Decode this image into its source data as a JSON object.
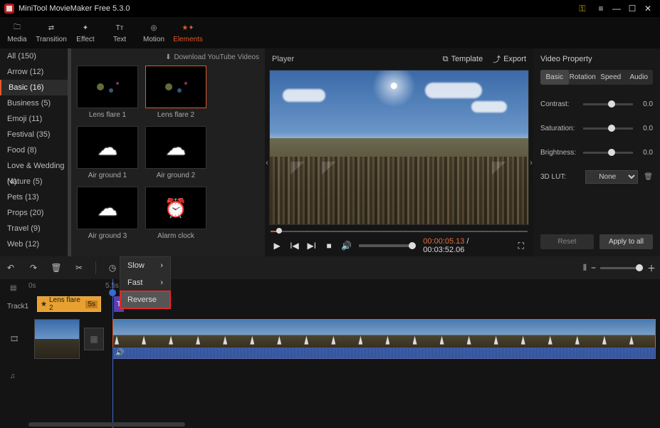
{
  "title": "MiniTool MovieMaker Free 5.3.0",
  "toolbar": [
    {
      "id": "media",
      "label": "Media",
      "icon": "folder"
    },
    {
      "id": "transition",
      "label": "Transition",
      "icon": "swap"
    },
    {
      "id": "effect",
      "label": "Effect",
      "icon": "sparkle"
    },
    {
      "id": "text",
      "label": "Text",
      "icon": "tt"
    },
    {
      "id": "motion",
      "label": "Motion",
      "icon": "motion"
    },
    {
      "id": "elements",
      "label": "Elements",
      "icon": "star",
      "active": true
    }
  ],
  "download_label": "Download YouTube Videos",
  "categories": [
    {
      "label": "All (150)"
    },
    {
      "label": "Arrow (12)"
    },
    {
      "label": "Basic (16)",
      "active": true
    },
    {
      "label": "Business (5)"
    },
    {
      "label": "Emoji (11)"
    },
    {
      "label": "Festival (35)"
    },
    {
      "label": "Food (8)"
    },
    {
      "label": "Love & Wedding (4)"
    },
    {
      "label": "Nature (5)"
    },
    {
      "label": "Pets (13)"
    },
    {
      "label": "Props (20)"
    },
    {
      "label": "Travel (9)"
    },
    {
      "label": "Web (12)"
    }
  ],
  "elements_grid": [
    {
      "label": "Lens flare 1",
      "kind": "flare"
    },
    {
      "label": "Lens flare 2",
      "kind": "flare",
      "selected": true
    },
    {
      "label": "Air ground 1",
      "kind": "puff"
    },
    {
      "label": "Air ground 2",
      "kind": "puff"
    },
    {
      "label": "Air ground 3",
      "kind": "puff"
    },
    {
      "label": "Alarm clock",
      "kind": "clock"
    }
  ],
  "player": {
    "title": "Player",
    "template": "Template",
    "export": "Export",
    "time_current": "00:00:05.13",
    "time_duration": "00:03:52.06"
  },
  "props": {
    "title": "Video Property",
    "tabs": [
      "Basic",
      "Rotation",
      "Speed",
      "Audio"
    ],
    "active_tab": "Basic",
    "contrast": {
      "label": "Contrast:",
      "value": "0.0"
    },
    "saturation": {
      "label": "Saturation:",
      "value": "0.0"
    },
    "brightness": {
      "label": "Brightness:",
      "value": "0.0"
    },
    "lut": {
      "label": "3D LUT:",
      "value": "None"
    },
    "reset": "Reset",
    "apply": "Apply to all"
  },
  "speed_menu": [
    "Slow",
    "Fast",
    "Reverse"
  ],
  "speed_menu_highlight": "Reverse",
  "timeline": {
    "zero": "0s",
    "five": "5.5s",
    "track_label": "Track1",
    "element_clip": {
      "label": "Lens flare 2",
      "duration": "5s"
    },
    "transition_clip": "T"
  }
}
